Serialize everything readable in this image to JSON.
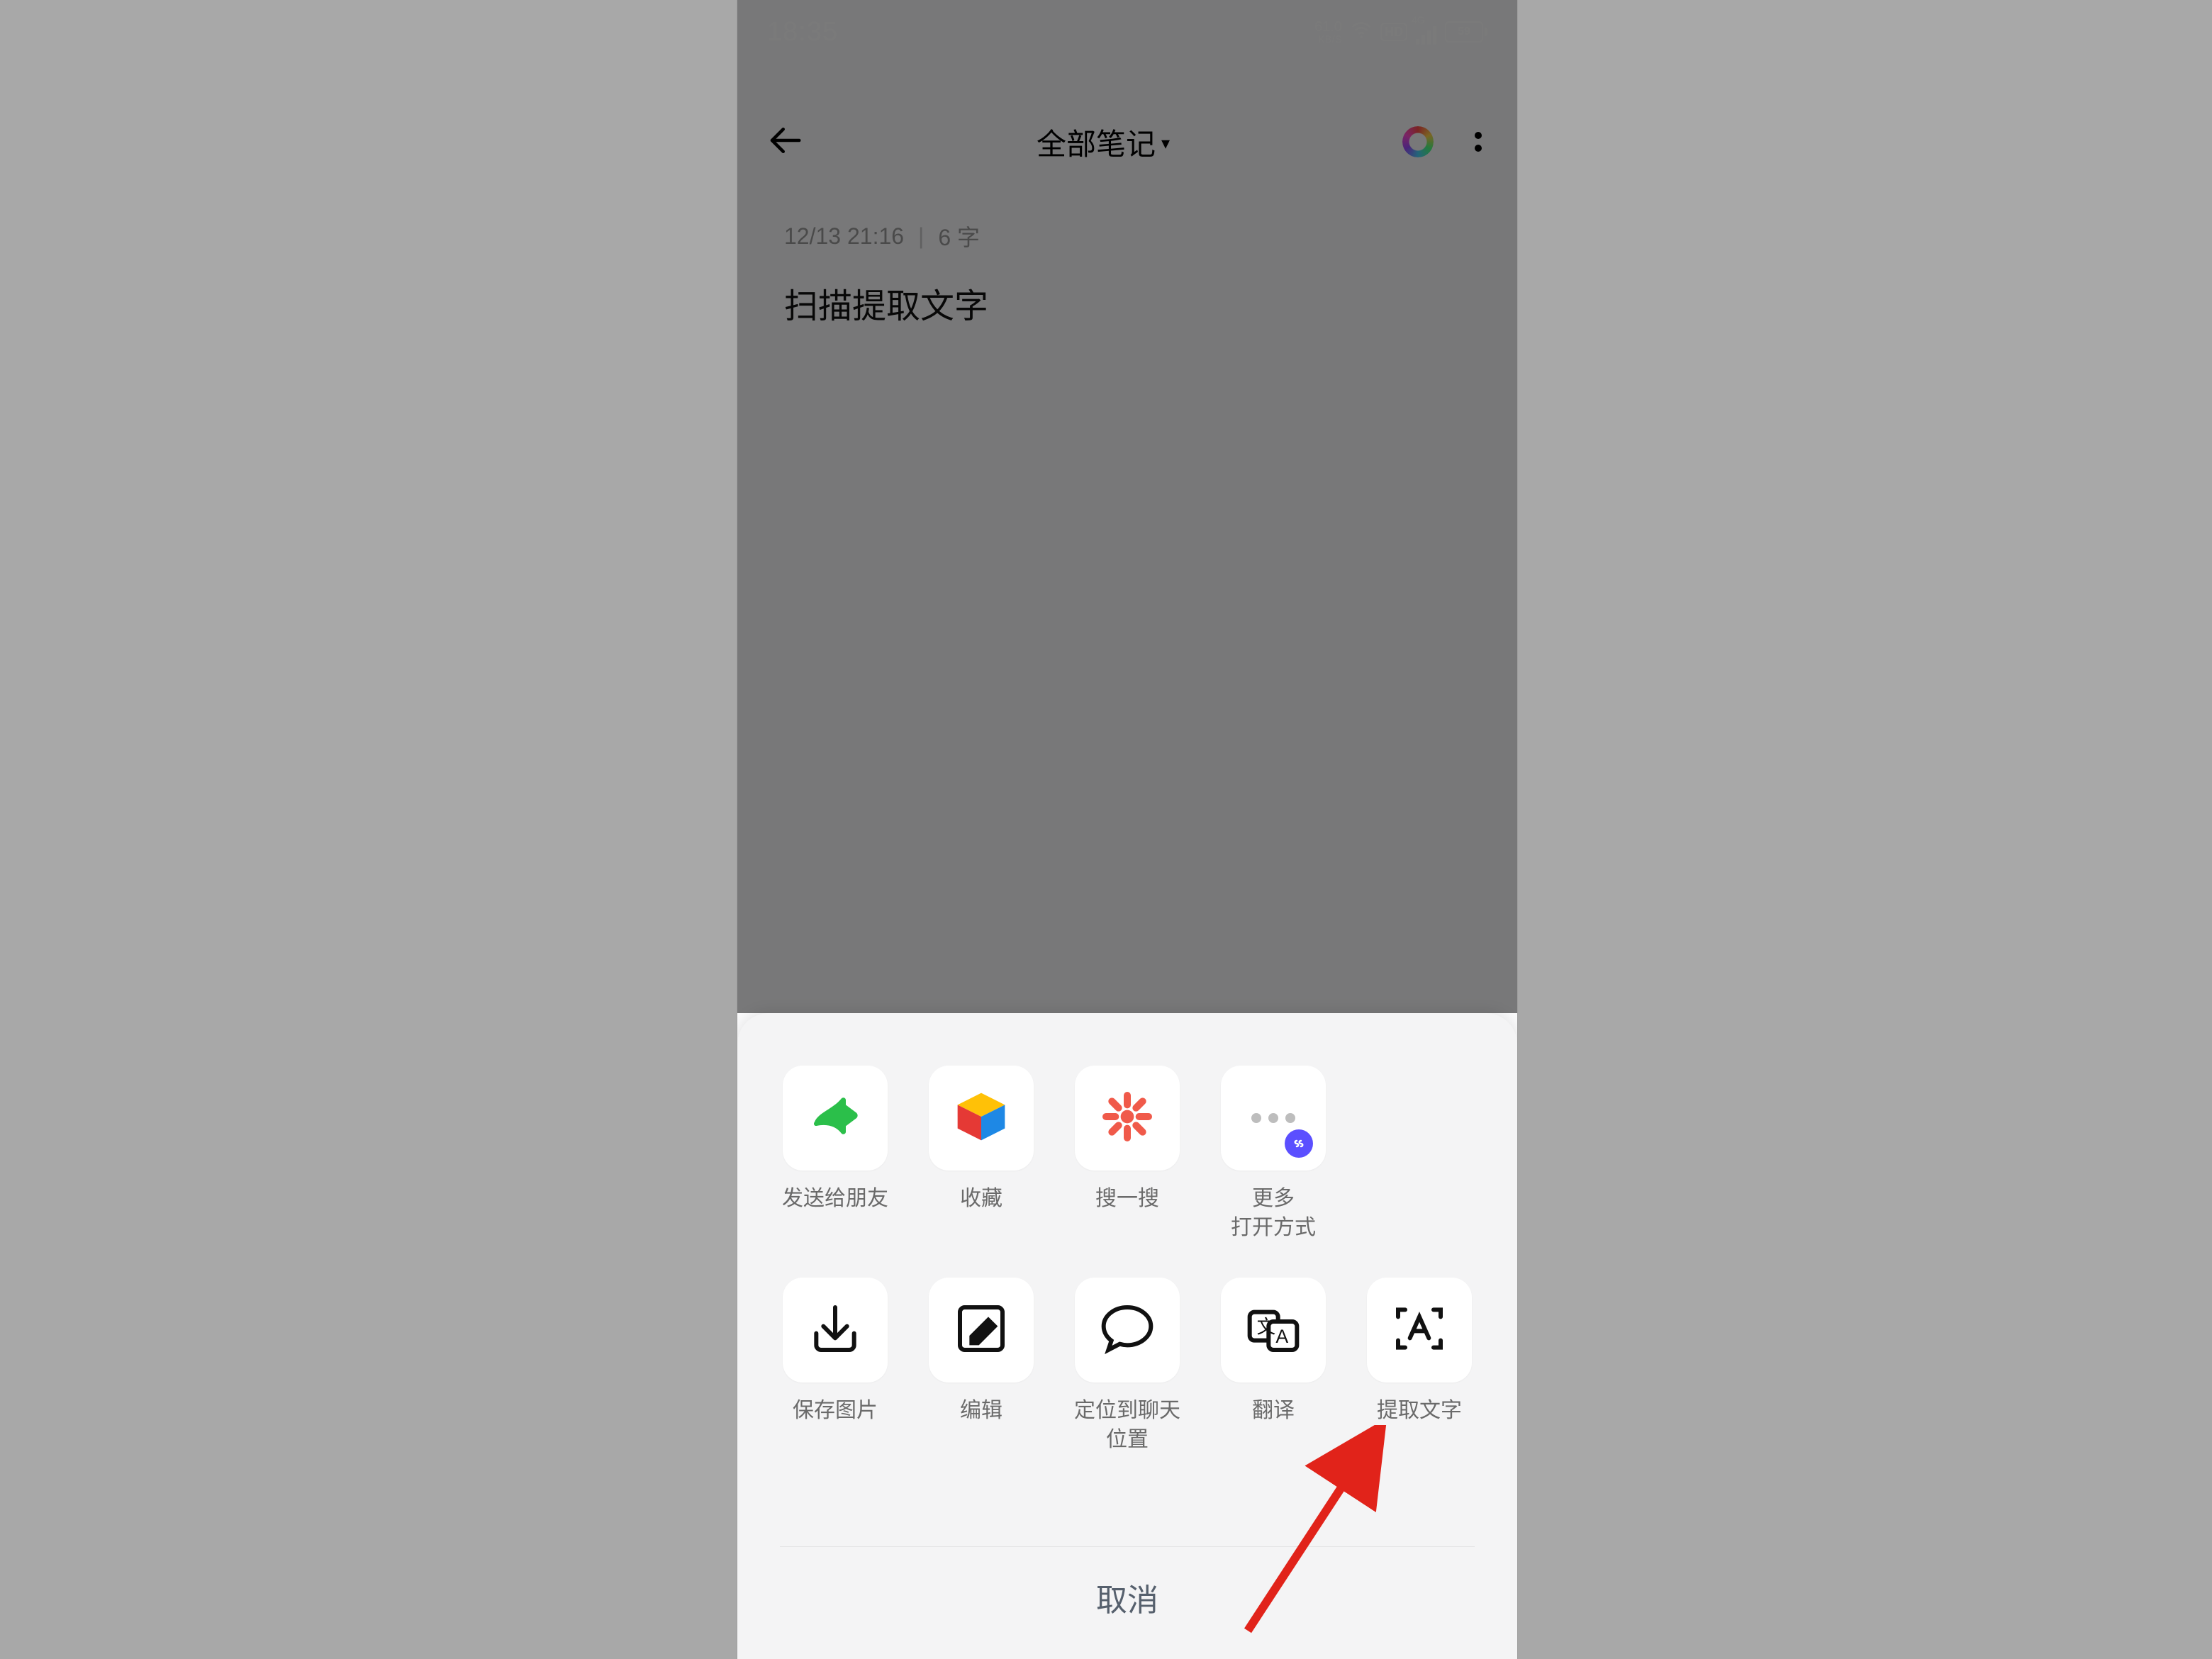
{
  "status": {
    "time": "18:35",
    "net_speed_value": "61.0",
    "net_speed_unit": "KB/S",
    "hd": "HD",
    "signal_gen": "4G",
    "battery": "59"
  },
  "appbar": {
    "title": "全部笔记"
  },
  "note": {
    "timestamp": "12/13 21:16",
    "word_count": "6 字",
    "title": "扫描提取文字"
  },
  "sheet": {
    "row1": [
      {
        "key": "send-to-friends",
        "label": "发送给朋友"
      },
      {
        "key": "favorite",
        "label": "收藏"
      },
      {
        "key": "search",
        "label": "搜一搜"
      },
      {
        "key": "open-with-more",
        "label": "更多\n打开方式"
      }
    ],
    "row2": [
      {
        "key": "save-image",
        "label": "保存图片"
      },
      {
        "key": "edit",
        "label": "编辑"
      },
      {
        "key": "locate-in-chat",
        "label": "定位到聊天\n位置"
      },
      {
        "key": "translate",
        "label": "翻译"
      },
      {
        "key": "extract-text",
        "label": "提取文字"
      }
    ],
    "cancel": "取消"
  }
}
